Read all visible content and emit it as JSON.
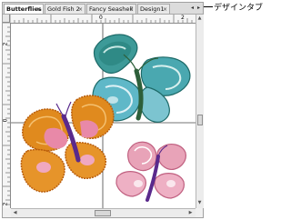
{
  "tabs": [
    {
      "label": "Butterflies",
      "active": true
    },
    {
      "label": "Gold Fish 2",
      "active": false
    },
    {
      "label": "Fancy Seashell",
      "active": false
    },
    {
      "label": "Design1",
      "active": false
    }
  ],
  "tab_close_glyph": "×",
  "tab_nav_prev": "◂",
  "tab_nav_next": "▸",
  "ruler": {
    "top_labels": [
      "0",
      "2"
    ],
    "left_labels": [
      "2",
      "0",
      "2"
    ]
  },
  "callout": {
    "label": "デザインタブ"
  },
  "colors": {
    "orange_wing": "#e08a1e",
    "teal_wing": "#3d9a98",
    "pink_wing": "#e8a3b8",
    "body_purple": "#5a2a8c"
  }
}
